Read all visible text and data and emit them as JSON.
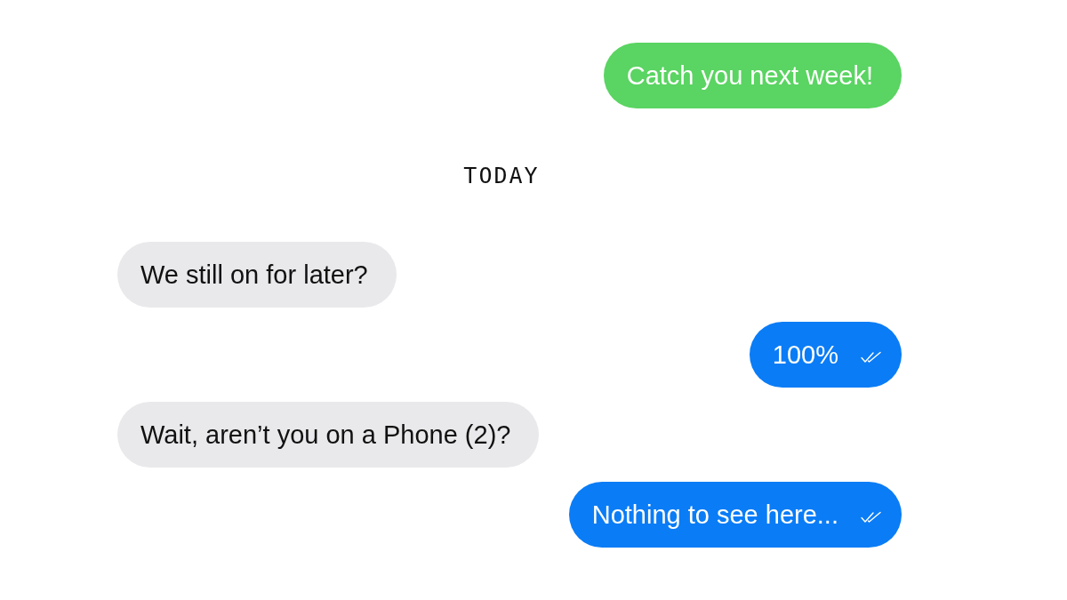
{
  "thread": [
    {
      "kind": "sent",
      "text": "Catch you next week!",
      "color": "#5ad462",
      "read_receipt": false
    },
    {
      "kind": "divider",
      "text": "TODAY"
    },
    {
      "kind": "received",
      "text": "We still on for later?",
      "color": "#e9e9eb"
    },
    {
      "kind": "sent",
      "text": "100%",
      "color": "#0a7cf6",
      "read_receipt": true
    },
    {
      "kind": "received",
      "text": "Wait, aren’t you on a Phone (2)?",
      "color": "#e9e9eb"
    },
    {
      "kind": "sent",
      "text": "Nothing to see here...",
      "color": "#0a7cf6",
      "read_receipt": true
    }
  ]
}
